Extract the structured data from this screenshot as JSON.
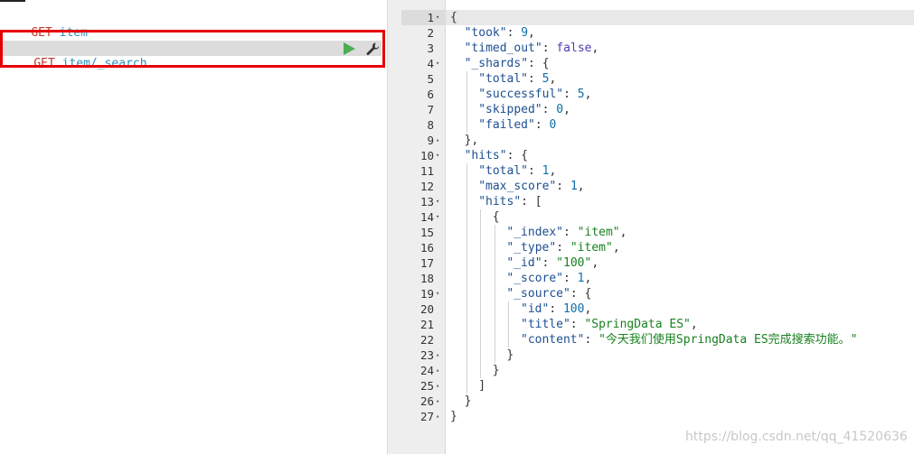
{
  "requests": [
    {
      "method": "GET",
      "path": "item"
    },
    {
      "method": "GET",
      "path": "item/_search"
    }
  ],
  "request_actions": {
    "run_icon": "play-icon",
    "settings_icon": "wrench-icon"
  },
  "response": {
    "lines": [
      {
        "n": "1",
        "fold": "▾",
        "indent": 0,
        "tokens": [
          [
            "p",
            "{"
          ]
        ]
      },
      {
        "n": "2",
        "fold": "",
        "indent": 1,
        "tokens": [
          [
            "k",
            "\"took\""
          ],
          [
            "p",
            ": "
          ],
          [
            "n",
            "9"
          ],
          [
            "p",
            ","
          ]
        ]
      },
      {
        "n": "3",
        "fold": "",
        "indent": 1,
        "tokens": [
          [
            "k",
            "\"timed_out\""
          ],
          [
            "p",
            ": "
          ],
          [
            "b",
            "false"
          ],
          [
            "p",
            ","
          ]
        ]
      },
      {
        "n": "4",
        "fold": "▾",
        "indent": 1,
        "tokens": [
          [
            "k",
            "\"_shards\""
          ],
          [
            "p",
            ": {"
          ]
        ]
      },
      {
        "n": "5",
        "fold": "",
        "indent": 2,
        "tokens": [
          [
            "k",
            "\"total\""
          ],
          [
            "p",
            ": "
          ],
          [
            "n",
            "5"
          ],
          [
            "p",
            ","
          ]
        ]
      },
      {
        "n": "6",
        "fold": "",
        "indent": 2,
        "tokens": [
          [
            "k",
            "\"successful\""
          ],
          [
            "p",
            ": "
          ],
          [
            "n",
            "5"
          ],
          [
            "p",
            ","
          ]
        ]
      },
      {
        "n": "7",
        "fold": "",
        "indent": 2,
        "tokens": [
          [
            "k",
            "\"skipped\""
          ],
          [
            "p",
            ": "
          ],
          [
            "n",
            "0"
          ],
          [
            "p",
            ","
          ]
        ]
      },
      {
        "n": "8",
        "fold": "",
        "indent": 2,
        "tokens": [
          [
            "k",
            "\"failed\""
          ],
          [
            "p",
            ": "
          ],
          [
            "n",
            "0"
          ]
        ]
      },
      {
        "n": "9",
        "fold": "▴",
        "indent": 1,
        "tokens": [
          [
            "p",
            "},"
          ]
        ]
      },
      {
        "n": "10",
        "fold": "▾",
        "indent": 1,
        "tokens": [
          [
            "k",
            "\"hits\""
          ],
          [
            "p",
            ": {"
          ]
        ]
      },
      {
        "n": "11",
        "fold": "",
        "indent": 2,
        "tokens": [
          [
            "k",
            "\"total\""
          ],
          [
            "p",
            ": "
          ],
          [
            "n",
            "1"
          ],
          [
            "p",
            ","
          ]
        ]
      },
      {
        "n": "12",
        "fold": "",
        "indent": 2,
        "tokens": [
          [
            "k",
            "\"max_score\""
          ],
          [
            "p",
            ": "
          ],
          [
            "n",
            "1"
          ],
          [
            "p",
            ","
          ]
        ]
      },
      {
        "n": "13",
        "fold": "▾",
        "indent": 2,
        "tokens": [
          [
            "k",
            "\"hits\""
          ],
          [
            "p",
            ": ["
          ]
        ]
      },
      {
        "n": "14",
        "fold": "▾",
        "indent": 3,
        "tokens": [
          [
            "p",
            "{"
          ]
        ]
      },
      {
        "n": "15",
        "fold": "",
        "indent": 4,
        "tokens": [
          [
            "k",
            "\"_index\""
          ],
          [
            "p",
            ": "
          ],
          [
            "s",
            "\"item\""
          ],
          [
            "p",
            ","
          ]
        ]
      },
      {
        "n": "16",
        "fold": "",
        "indent": 4,
        "tokens": [
          [
            "k",
            "\"_type\""
          ],
          [
            "p",
            ": "
          ],
          [
            "s",
            "\"item\""
          ],
          [
            "p",
            ","
          ]
        ]
      },
      {
        "n": "17",
        "fold": "",
        "indent": 4,
        "tokens": [
          [
            "k",
            "\"_id\""
          ],
          [
            "p",
            ": "
          ],
          [
            "s",
            "\"100\""
          ],
          [
            "p",
            ","
          ]
        ]
      },
      {
        "n": "18",
        "fold": "",
        "indent": 4,
        "tokens": [
          [
            "k",
            "\"_score\""
          ],
          [
            "p",
            ": "
          ],
          [
            "n",
            "1"
          ],
          [
            "p",
            ","
          ]
        ]
      },
      {
        "n": "19",
        "fold": "▾",
        "indent": 4,
        "tokens": [
          [
            "k",
            "\"_source\""
          ],
          [
            "p",
            ": {"
          ]
        ]
      },
      {
        "n": "20",
        "fold": "",
        "indent": 5,
        "tokens": [
          [
            "k",
            "\"id\""
          ],
          [
            "p",
            ": "
          ],
          [
            "n",
            "100"
          ],
          [
            "p",
            ","
          ]
        ]
      },
      {
        "n": "21",
        "fold": "",
        "indent": 5,
        "tokens": [
          [
            "k",
            "\"title\""
          ],
          [
            "p",
            ": "
          ],
          [
            "s",
            "\"SpringData ES\""
          ],
          [
            "p",
            ","
          ]
        ]
      },
      {
        "n": "22",
        "fold": "",
        "indent": 5,
        "tokens": [
          [
            "k",
            "\"content\""
          ],
          [
            "p",
            ": "
          ],
          [
            "s",
            "\"今天我们使用SpringData ES完成搜索功能。\""
          ]
        ]
      },
      {
        "n": "23",
        "fold": "▴",
        "indent": 4,
        "tokens": [
          [
            "p",
            "}"
          ]
        ]
      },
      {
        "n": "24",
        "fold": "▴",
        "indent": 3,
        "tokens": [
          [
            "p",
            "}"
          ]
        ]
      },
      {
        "n": "25",
        "fold": "▴",
        "indent": 2,
        "tokens": [
          [
            "p",
            "]"
          ]
        ]
      },
      {
        "n": "26",
        "fold": "▴",
        "indent": 1,
        "tokens": [
          [
            "p",
            "}"
          ]
        ]
      },
      {
        "n": "27",
        "fold": "▴",
        "indent": 0,
        "tokens": [
          [
            "p",
            "}"
          ]
        ]
      }
    ]
  },
  "watermark": "https://blog.csdn.net/qq_41520636",
  "colors": {
    "method": "#c0392b",
    "path": "#2a8fbd",
    "highlight": "#e60000",
    "run": "#4caf50"
  }
}
